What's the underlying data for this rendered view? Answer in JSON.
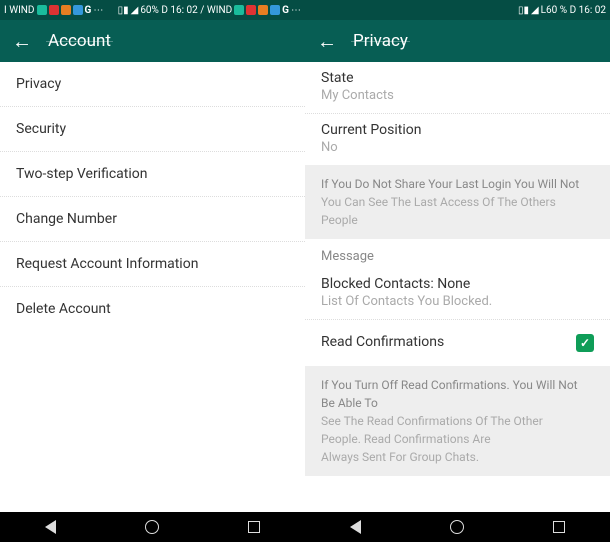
{
  "left": {
    "status": {
      "carrier": "I WIND",
      "right_text": "60% D 16: 02 / WIND"
    },
    "header": {
      "title": "Account"
    },
    "items": [
      "Privacy",
      "Security",
      "Two-step Verification",
      "Change Number",
      "Request Account Information",
      "Delete Account"
    ]
  },
  "right": {
    "status": {
      "right_text": "L60 % D 16: 02"
    },
    "header": {
      "title": "Privacy"
    },
    "state": {
      "title": "State",
      "value": "My Contacts"
    },
    "position": {
      "title": "Current Position",
      "value": "No"
    },
    "login_info": {
      "line1": "If You Do Not Share Your Last Login You Will Not",
      "line2": "You Can See The Last Access Of The Others",
      "line3": "People"
    },
    "message_label": "Message",
    "blocked": {
      "title": "Blocked Contacts: None",
      "sub": "List Of Contacts You Blocked."
    },
    "read_confirm": {
      "label": "Read Confirmations",
      "checked": true
    },
    "read_info": {
      "line1": "If You Turn Off Read Confirmations. You Will Not Be Able To",
      "line2": "See The Read Confirmations Of The Other",
      "line3": "People. Read Confirmations Are",
      "line4": "Always Sent For Group Chats."
    }
  }
}
